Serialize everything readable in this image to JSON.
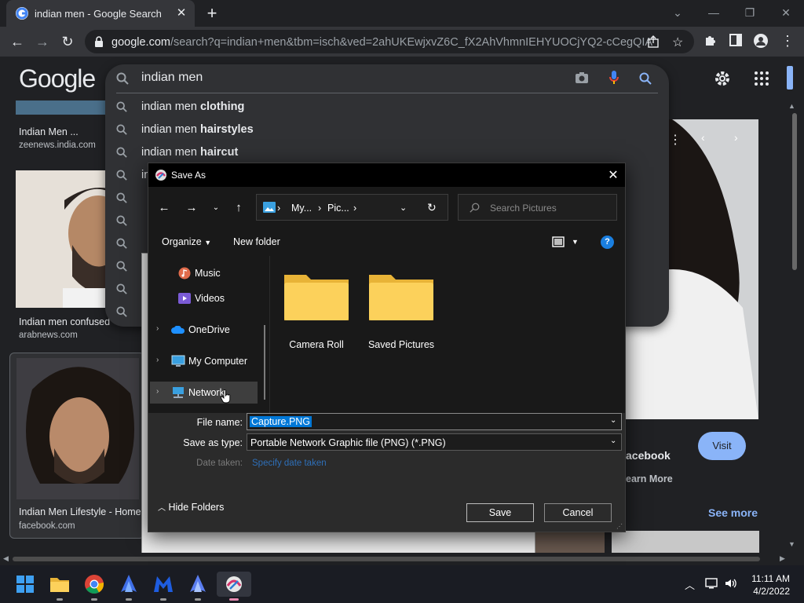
{
  "browser": {
    "tab_title": "indian men - Google Search",
    "url_host": "google.com",
    "url_path": "/search?q=indian+men&tbm=isch&ved=2ahUKEwjxvZ6C_fX2AhVhmnIEHYUOCjYQ2-cCegQIAB..."
  },
  "google": {
    "logo": "Google",
    "query": "indian men",
    "suggestions": [
      {
        "base": "indian men ",
        "bold": "clothing"
      },
      {
        "base": "indian men ",
        "bold": "hairstyles"
      },
      {
        "base": "indian men ",
        "bold": "haircut"
      },
      {
        "base": "in",
        "bold": ""
      }
    ],
    "results": [
      {
        "caption": "Indian Men ...",
        "domain": "zeenews.india.com"
      },
      {
        "caption": "Indian men confused",
        "domain": "arabnews.com"
      },
      {
        "caption": "Indian Men Lifestyle - Home",
        "domain": "facebook.com"
      }
    ],
    "side_panel": {
      "source": "acebook",
      "learn_more": "earn More",
      "visit": "Visit",
      "see_more": "See more"
    }
  },
  "dialog": {
    "title": "Save As",
    "breadcrumbs": [
      "My...",
      "Pic..."
    ],
    "search_placeholder": "Search Pictures",
    "organize": "Organize",
    "new_folder": "New folder",
    "nav_items": [
      "Music",
      "Videos",
      "OneDrive",
      "My Computer",
      "Network"
    ],
    "folders": [
      "Camera Roll",
      "Saved Pictures"
    ],
    "file_name_label": "File name:",
    "file_name_value": "Capture.PNG",
    "save_type_label": "Save as type:",
    "save_type_value": "Portable Network Graphic file (PNG) (*.PNG)",
    "date_taken_label": "Date taken:",
    "date_taken_value": "Specify date taken",
    "hide_folders": "Hide Folders",
    "save": "Save",
    "cancel": "Cancel"
  },
  "taskbar": {
    "time": "11:11 AM",
    "date": "4/2/2022"
  },
  "colors": {
    "chrome_dark": "#202124",
    "chrome_toolbar": "#35363a",
    "accent_blue": "#8ab4f8",
    "selection_blue": "#0078d7"
  }
}
